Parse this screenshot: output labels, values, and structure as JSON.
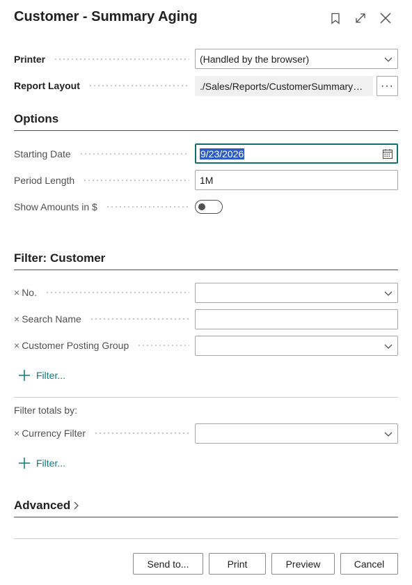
{
  "header": {
    "title": "Customer - Summary Aging"
  },
  "general": {
    "printer_label": "Printer",
    "printer_value": "(Handled by the browser)",
    "layout_label": "Report Layout",
    "layout_value": "./Sales/Reports/CustomerSummaryAging.rdlc",
    "layout_more": "···"
  },
  "options": {
    "title": "Options",
    "starting_date_label": "Starting Date",
    "starting_date_value": "9/23/2026",
    "period_length_label": "Period Length",
    "period_length_value": "1M",
    "show_amounts_label": "Show Amounts in $",
    "show_amounts_on": false
  },
  "filter_customer": {
    "title": "Filter: Customer",
    "remove_glyph": "×",
    "fields": [
      {
        "label": "No.",
        "value": ""
      },
      {
        "label": "Search Name",
        "value": ""
      },
      {
        "label": "Customer Posting Group",
        "value": ""
      }
    ],
    "add_filter": "Filter..."
  },
  "filter_totals": {
    "title": "Filter totals by:",
    "fields": [
      {
        "label": "Currency Filter",
        "value": ""
      }
    ],
    "add_filter": "Filter..."
  },
  "advanced": {
    "title": "Advanced"
  },
  "buttons": {
    "send_to": "Send to...",
    "print": "Print",
    "preview": "Preview",
    "cancel": "Cancel"
  },
  "icons": {
    "bookmark": "bookmark-icon",
    "expand": "expand-icon",
    "close": "close-icon",
    "chevron": "chevron-down-icon",
    "calendar": "calendar-icon",
    "plus": "plus-icon"
  },
  "colors": {
    "accent": "#0f6e6e",
    "link": "#0f7b7b",
    "selection": "#2e5cc7"
  }
}
